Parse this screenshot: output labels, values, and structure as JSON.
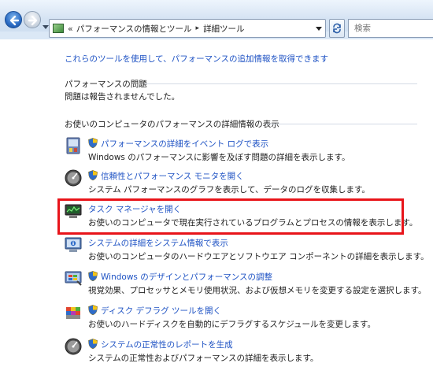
{
  "address_bar": {
    "overflow_chevron": "«",
    "crumbs": [
      "パフォーマンスの情報とツール",
      "詳細ツール"
    ],
    "separator": "▸"
  },
  "search": {
    "placeholder": "検索"
  },
  "intro_link": "これらのツールを使用して、パフォーマンスの追加情報を取得できます",
  "problems": {
    "heading": "パフォーマンスの問題",
    "status": "問題は報告されませんでした。"
  },
  "details": {
    "heading": "お使いのコンピュータのパフォーマンスの詳細情報の表示",
    "items": [
      {
        "icon": "event-log-icon",
        "shield": true,
        "link": "パフォーマンスの詳細をイベント ログで表示",
        "desc": "Windows のパフォーマンスに影響を及ぼす問題の詳細を表示します。"
      },
      {
        "icon": "performance-monitor-icon",
        "shield": true,
        "link": "信頼性とパフォーマンス モニタを開く",
        "desc": "システム パフォーマンスのグラフを表示して、データのログを収集します。"
      },
      {
        "icon": "task-manager-icon",
        "shield": false,
        "link": "タスク マネージャを開く",
        "desc": "お使いのコンピュータで現在実行されているプログラムとプロセスの情報を表示します。"
      },
      {
        "icon": "system-information-icon",
        "shield": false,
        "link": "システムの詳細をシステム情報で表示",
        "desc": "お使いのコンピュータのハードウエアとソフトウエア コンポーネントの詳細を表示します。"
      },
      {
        "icon": "windows-appearance-icon",
        "shield": true,
        "link": "Windows のデザインとパフォーマンスの調整",
        "desc": "視覚効果、プロセッサとメモリ使用状況、および仮想メモリを変更する設定を選択します。"
      },
      {
        "icon": "disk-defrag-icon",
        "shield": true,
        "link": "ディスク デフラグ ツールを開く",
        "desc": "お使いのハードディスクを自動的にデフラグするスケジュールを変更します。"
      },
      {
        "icon": "system-health-report-icon",
        "shield": true,
        "link": "システムの正常性のレポートを生成",
        "desc": "システムの正常性およびパフォーマンスの詳細を表示します。"
      }
    ]
  },
  "colors": {
    "link": "#1f53c4",
    "highlight": "#e8141a"
  }
}
